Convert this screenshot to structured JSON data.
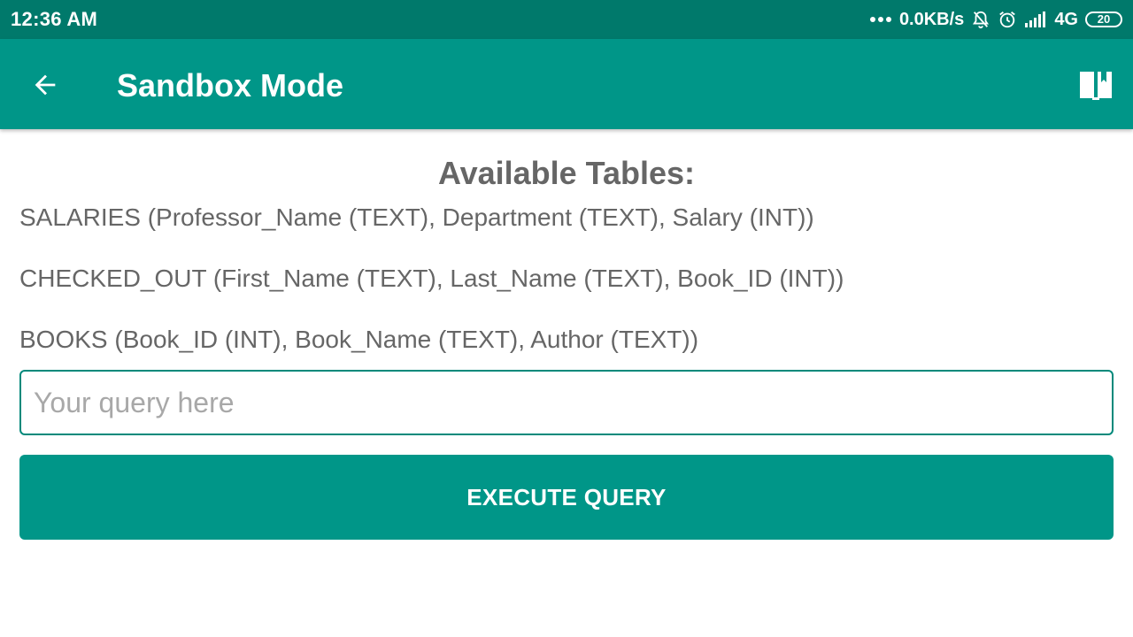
{
  "status_bar": {
    "time": "12:36 AM",
    "net_speed": "0.0KB/s",
    "network_type": "4G",
    "battery": "20",
    "icons": [
      "more-dots-icon",
      "bell-off-icon",
      "alarm-clock-icon",
      "signal-icon",
      "battery-icon"
    ]
  },
  "app_bar": {
    "title": "Sandbox Mode",
    "back_icon": "arrow-left-icon",
    "action_icon": "book-open-icon"
  },
  "main": {
    "heading": "Available Tables:",
    "tables": [
      "SALARIES (Professor_Name (TEXT), Department (TEXT), Salary (INT))",
      "CHECKED_OUT (First_Name (TEXT), Last_Name (TEXT), Book_ID (INT))",
      "BOOKS (Book_ID (INT), Book_Name (TEXT), Author (TEXT))"
    ],
    "query_input": {
      "value": "",
      "placeholder": "Your query here"
    },
    "execute_label": "EXECUTE QUERY"
  },
  "colors": {
    "status_bar": "#00796b",
    "primary": "#009688",
    "text_muted": "#666666",
    "placeholder": "#a8a8a8"
  }
}
